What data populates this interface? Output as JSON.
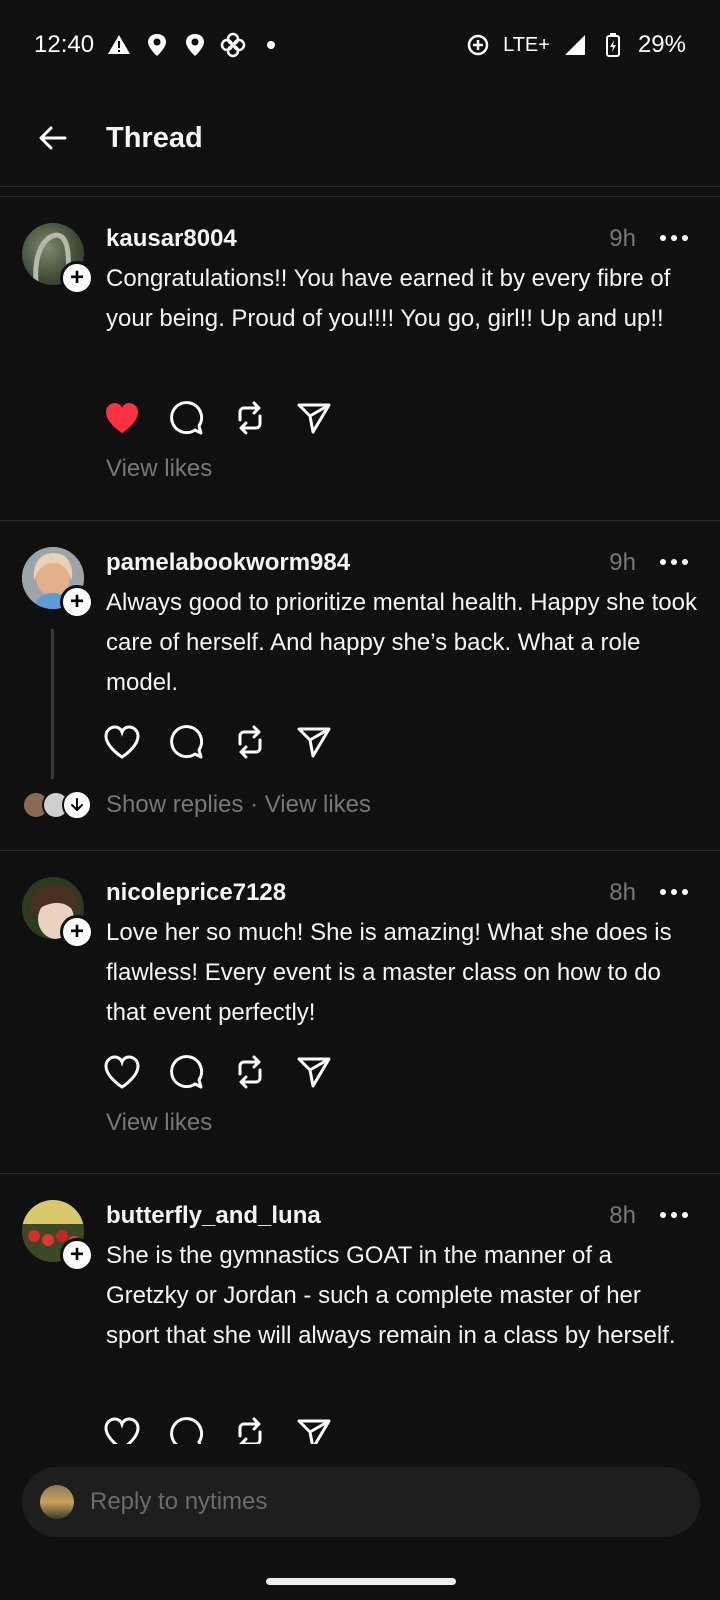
{
  "status": {
    "time": "12:40",
    "network": "LTE+",
    "battery": "29%",
    "icons_left": [
      "warning-icon",
      "location-icon",
      "location-icon",
      "pinwheel-icon",
      "dot-icon"
    ],
    "icons_right": [
      "data-saver-icon",
      "signal-icon",
      "battery-icon"
    ]
  },
  "header": {
    "title": "Thread"
  },
  "posts": [
    {
      "username": "kausar8004",
      "time": "9h",
      "text": "Congratulations!! You have earned it by every fibre of your being. Proud of you!!!! You go, girl!! Up and up!!",
      "liked": true,
      "meta": "View likes"
    },
    {
      "username": "pamelabookworm984",
      "time": "9h",
      "text": "Always good to prioritize mental health. Happy she took care of herself. And happy she’s back. What a role model.",
      "liked": false,
      "show_replies": "Show replies",
      "separator": " · ",
      "meta": "View likes"
    },
    {
      "username": "nicoleprice7128",
      "time": "8h",
      "text": "Love her so much! She is amazing! What she does is flawless! Every event is a master class on how to do that event perfectly!",
      "liked": false,
      "meta": "View likes"
    },
    {
      "username": "butterfly_and_luna",
      "time": "8h",
      "text": "She is the gymnastics GOAT in the manner of a Gretzky or Jordan - such a complete master of her sport that she will always remain in a class by herself.",
      "liked": false
    }
  ],
  "reply": {
    "placeholder": "Reply to nytimes"
  },
  "colors": {
    "background": "#101010",
    "like_red": "#ff3040",
    "muted": "#777777"
  }
}
